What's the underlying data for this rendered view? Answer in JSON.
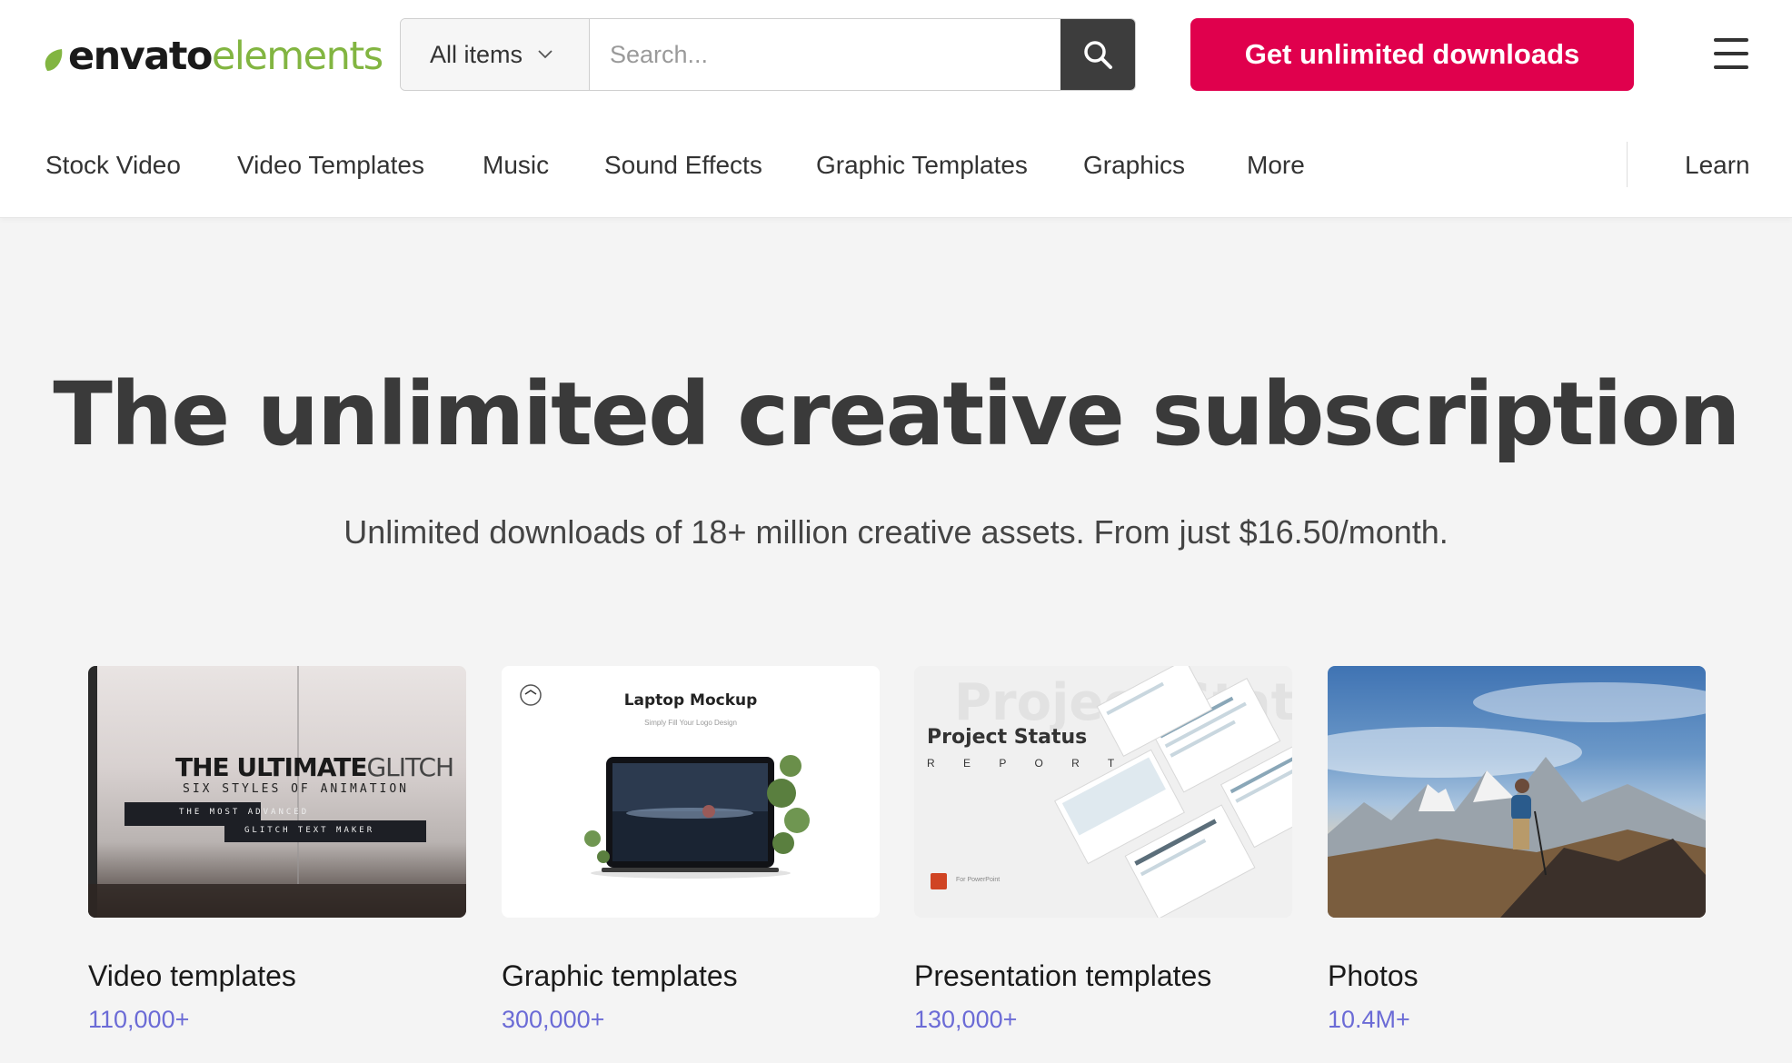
{
  "brand": {
    "logo_part1": "envato",
    "logo_part2": "elements",
    "accent_green": "#82b541",
    "cta_color": "#e0004d"
  },
  "search": {
    "category": "All items",
    "placeholder": "Search..."
  },
  "header": {
    "cta_label": "Get unlimited downloads"
  },
  "nav": {
    "items": [
      "Stock Video",
      "Video Templates",
      "Music",
      "Sound Effects",
      "Graphic Templates",
      "Graphics",
      "More"
    ],
    "learn": "Learn"
  },
  "hero": {
    "title": "The unlimited creative subscription",
    "subtitle": "Unlimited downloads of 18+ million creative assets. From just $16.50/month."
  },
  "cards": [
    {
      "label": "Video templates",
      "count": "110,000+",
      "thumb": {
        "title_bold": "THE ULTIMATE",
        "title_light": "GLITCH",
        "line1": "SIX STYLES OF ANIMATION",
        "line2": "THE MOST ADVANCED",
        "line3": "GLITCH TEXT MAKER"
      }
    },
    {
      "label": "Graphic templates",
      "count": "300,000+",
      "thumb": {
        "title": "Laptop Mockup",
        "subtitle": "Simply Fill Your Logo Design"
      }
    },
    {
      "label": "Presentation templates",
      "count": "130,000+",
      "thumb": {
        "bg_text": "Project Statu",
        "title": "Project Status",
        "subtitle": "R E P O R T",
        "footer": "For PowerPoint"
      }
    },
    {
      "label": "Photos",
      "count": "10.4M+"
    }
  ]
}
